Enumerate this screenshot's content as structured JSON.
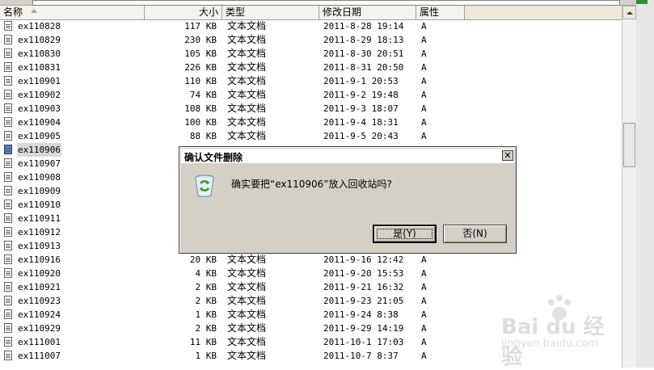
{
  "columns": {
    "name": "名称",
    "size": "大小",
    "type": "类型",
    "modified": "修改日期",
    "attributes": "属性"
  },
  "files": [
    {
      "name": "ex110828",
      "size": "117 KB",
      "type": "文本文档",
      "modified": "2011-8-28 19:14",
      "attr": "A"
    },
    {
      "name": "ex110829",
      "size": "230 KB",
      "type": "文本文档",
      "modified": "2011-8-29 18:13",
      "attr": "A"
    },
    {
      "name": "ex110830",
      "size": "105 KB",
      "type": "文本文档",
      "modified": "2011-8-30 20:51",
      "attr": "A"
    },
    {
      "name": "ex110831",
      "size": "226 KB",
      "type": "文本文档",
      "modified": "2011-8-31 20:50",
      "attr": "A"
    },
    {
      "name": "ex110901",
      "size": "110 KB",
      "type": "文本文档",
      "modified": "2011-9-1 20:53",
      "attr": "A"
    },
    {
      "name": "ex110902",
      "size": "74 KB",
      "type": "文本文档",
      "modified": "2011-9-2 19:48",
      "attr": "A"
    },
    {
      "name": "ex110903",
      "size": "108 KB",
      "type": "文本文档",
      "modified": "2011-9-3 18:07",
      "attr": "A"
    },
    {
      "name": "ex110904",
      "size": "100 KB",
      "type": "文本文档",
      "modified": "2011-9-4 18:31",
      "attr": "A"
    },
    {
      "name": "ex110905",
      "size": "88 KB",
      "type": "文本文档",
      "modified": "2011-9-5 20:43",
      "attr": "A"
    },
    {
      "name": "ex110906",
      "size": "",
      "type": "",
      "modified": "",
      "attr": "",
      "selected": true
    },
    {
      "name": "ex110907",
      "size": "",
      "type": "",
      "modified": "",
      "attr": ""
    },
    {
      "name": "ex110908",
      "size": "",
      "type": "",
      "modified": "",
      "attr": ""
    },
    {
      "name": "ex110909",
      "size": "",
      "type": "",
      "modified": "",
      "attr": ""
    },
    {
      "name": "ex110910",
      "size": "",
      "type": "",
      "modified": "",
      "attr": ""
    },
    {
      "name": "ex110911",
      "size": "",
      "type": "",
      "modified": "",
      "attr": ""
    },
    {
      "name": "ex110912",
      "size": "",
      "type": "",
      "modified": "",
      "attr": ""
    },
    {
      "name": "ex110913",
      "size": "",
      "type": "",
      "modified": "",
      "attr": ""
    },
    {
      "name": "ex110916",
      "size": "20 KB",
      "type": "文本文档",
      "modified": "2011-9-16 12:42",
      "attr": "A"
    },
    {
      "name": "ex110920",
      "size": "4 KB",
      "type": "文本文档",
      "modified": "2011-9-20 15:53",
      "attr": "A"
    },
    {
      "name": "ex110921",
      "size": "2 KB",
      "type": "文本文档",
      "modified": "2011-9-21 16:32",
      "attr": "A"
    },
    {
      "name": "ex110923",
      "size": "2 KB",
      "type": "文本文档",
      "modified": "2011-9-23 21:05",
      "attr": "A"
    },
    {
      "name": "ex110924",
      "size": "1 KB",
      "type": "文本文档",
      "modified": "2011-9-24 8:38",
      "attr": "A"
    },
    {
      "name": "ex110929",
      "size": "2 KB",
      "type": "文本文档",
      "modified": "2011-9-29 14:19",
      "attr": "A"
    },
    {
      "name": "ex111001",
      "size": "11 KB",
      "type": "文本文档",
      "modified": "2011-10-1 17:03",
      "attr": "A"
    },
    {
      "name": "ex111007",
      "size": "1 KB",
      "type": "文本文档",
      "modified": "2011-10-7 8:37",
      "attr": "A"
    }
  ],
  "dialog": {
    "title": "确认文件删除",
    "message": "确实要把“ex110906”放入回收站吗?",
    "yes_label": "是(Y)",
    "no_label": "否(N)",
    "close_glyph": "✕",
    "icon": "recycle-bin-icon"
  },
  "watermark": {
    "brand": "Bai du 经验",
    "site": "jingyan.baidu.com"
  },
  "colors": {
    "selected_row": "#d9d9d9",
    "dialog_bg": "#d4d0c8"
  }
}
